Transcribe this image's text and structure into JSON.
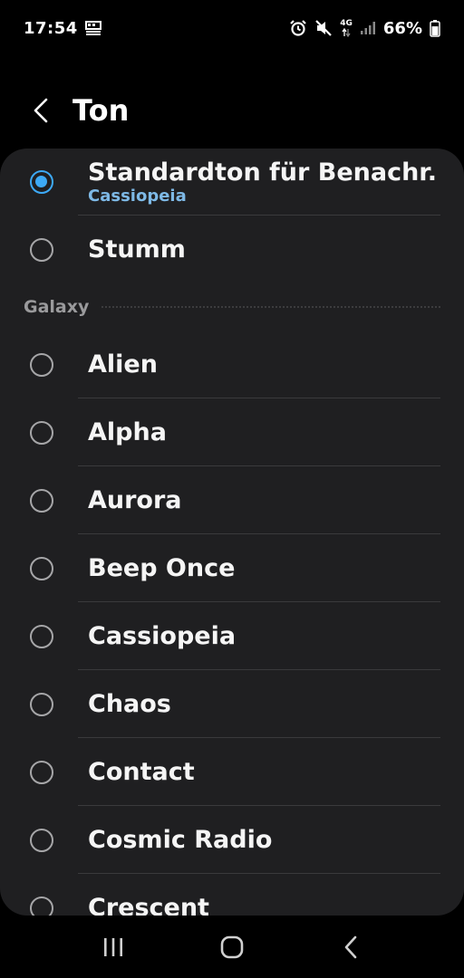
{
  "status_bar": {
    "time": "17:54",
    "battery_percent": "66%",
    "network": "4G",
    "icons": [
      "notification-icon",
      "alarm-icon",
      "mute-icon",
      "data-arrows-icon",
      "signal-icon",
      "battery-icon"
    ],
    "battery_level": 0.66
  },
  "header": {
    "title": "Ton"
  },
  "list": {
    "default": {
      "label": "Standardton für Benachr.",
      "sub": "Cassiopeia",
      "selected": true
    },
    "silent": {
      "label": "Stumm",
      "selected": false
    },
    "section_label": "Galaxy",
    "items": [
      {
        "label": "Alien",
        "selected": false
      },
      {
        "label": "Alpha",
        "selected": false
      },
      {
        "label": "Aurora",
        "selected": false
      },
      {
        "label": "Beep Once",
        "selected": false
      },
      {
        "label": "Cassiopeia",
        "selected": false
      },
      {
        "label": "Chaos",
        "selected": false
      },
      {
        "label": "Contact",
        "selected": false
      },
      {
        "label": "Cosmic Radio",
        "selected": false
      },
      {
        "label": "Crescent",
        "selected": false
      }
    ]
  },
  "colors": {
    "background": "#000000",
    "card": "#1f1f21",
    "accent": "#3da9f5",
    "sub_text": "#7eb9e6"
  },
  "nav": {
    "icons": [
      "recent-apps-icon",
      "home-icon",
      "back-icon"
    ]
  }
}
